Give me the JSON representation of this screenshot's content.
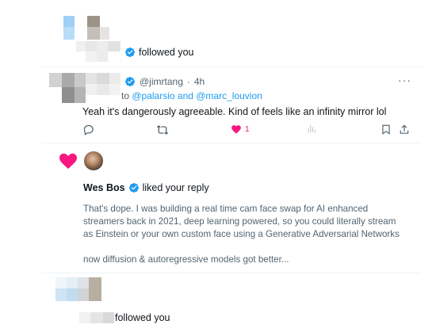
{
  "notifications": [
    {
      "type": "follow",
      "user_name": "",
      "action_text": "followed you",
      "verified": true
    },
    {
      "type": "reply",
      "handle": "@jimrtang",
      "separator": "·",
      "time": "4h",
      "replying_prefix": "to",
      "replying_mentions": "@palarsio and @marc_louvion",
      "body": "Yeah it's dangerously agreeable. Kind of feels like an infinity mirror lol",
      "more_label": "···",
      "actions": {
        "reply_icon": "reply-icon",
        "retweet_icon": "retweet-icon",
        "like_icon": "heart-filled-icon",
        "like_count": "1",
        "views_icon": "views-icon",
        "bookmark_icon": "bookmark-icon",
        "share_icon": "share-icon"
      }
    },
    {
      "type": "like",
      "user_name": "Wes Bos",
      "verified": true,
      "action_text": "liked your reply",
      "quote_paragraphs": [
        "That's dope. I was building a real time cam face swap for AI enhanced",
        "streamers back in 2021, deep learning powered, so you could literally stream",
        "as Einstein or your own custom face using a Generative Adversarial Networks",
        "now diffusion & autoregressive models got better..."
      ]
    },
    {
      "type": "follow",
      "user_name": "",
      "action_text": "followed you"
    }
  ],
  "colors": {
    "accent": "#1d9bf0",
    "like": "#f91880",
    "muted": "#536471",
    "text": "#0f1419",
    "border": "#eff3f4"
  }
}
